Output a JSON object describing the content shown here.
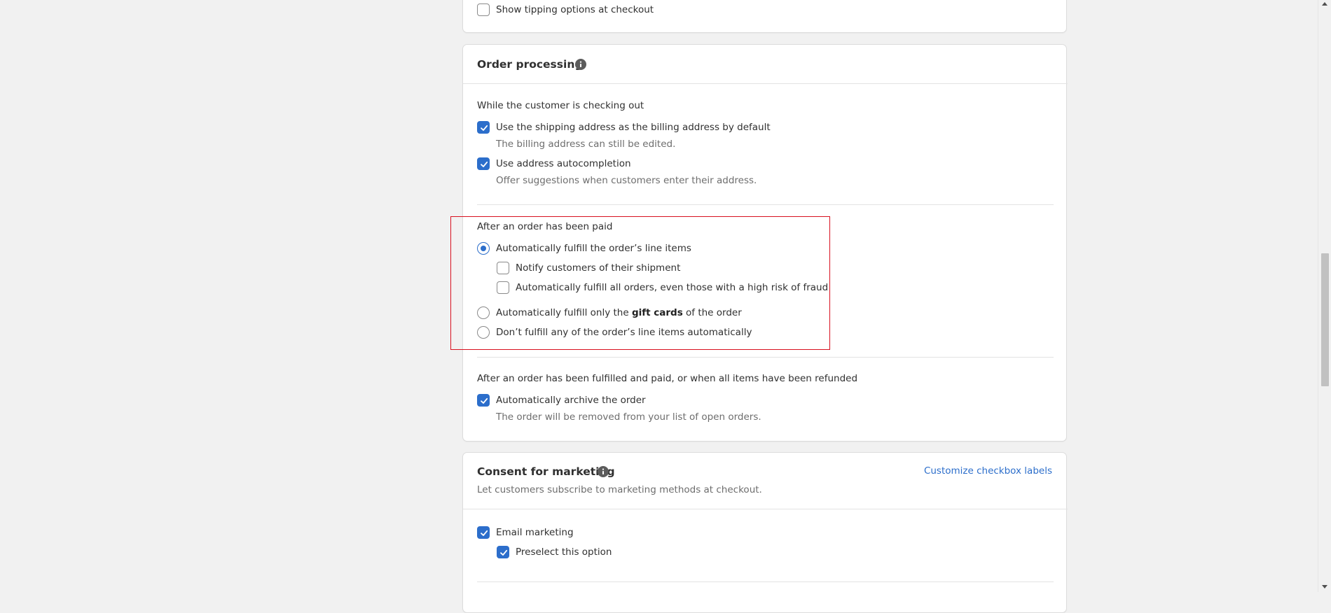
{
  "tipping": {
    "show_tipping_label": "Show tipping options at checkout",
    "show_tipping_checked": false
  },
  "order_processing": {
    "title": "Order processing",
    "info_icon": "info-icon",
    "checkout_section": {
      "heading": "While the customer is checking out",
      "options": [
        {
          "label": "Use the shipping address as the billing address by default",
          "help": "The billing address can still be edited.",
          "checked": true
        },
        {
          "label": "Use address autocompletion",
          "help": "Offer suggestions when customers enter their address.",
          "checked": true
        }
      ]
    },
    "paid_section": {
      "heading": "After an order has been paid",
      "radio_auto_fulfill": "Automatically fulfill the order’s line items",
      "radio_auto_fulfill_selected": true,
      "sub_options": [
        {
          "label": "Notify customers of their shipment",
          "checked": false
        },
        {
          "label": "Automatically fulfill all orders, even those with a high risk of fraud",
          "checked": false
        }
      ],
      "radio_gift_cards_prefix": "Automatically fulfill only the ",
      "radio_gift_cards_bold": "gift cards",
      "radio_gift_cards_suffix": " of the order",
      "radio_none": "Don’t fulfill any of the order’s line items automatically"
    },
    "archive_section": {
      "heading": "After an order has been fulfilled and paid, or when all items have been refunded",
      "label": "Automatically archive the order",
      "help": "The order will be removed from your list of open orders.",
      "checked": true
    }
  },
  "consent": {
    "title": "Consent for marketing",
    "info_icon": "info-icon",
    "subtitle": "Let customers subscribe to marketing methods at checkout.",
    "customize_link": "Customize checkbox labels",
    "email_label": "Email marketing",
    "email_checked": true,
    "preselect_label": "Preselect this option",
    "preselect_checked": true
  },
  "colors": {
    "accent": "#2c6ecb",
    "highlight_border": "#d8101f",
    "page_background": "#f1f1f1",
    "card_background": "#ffffff"
  }
}
